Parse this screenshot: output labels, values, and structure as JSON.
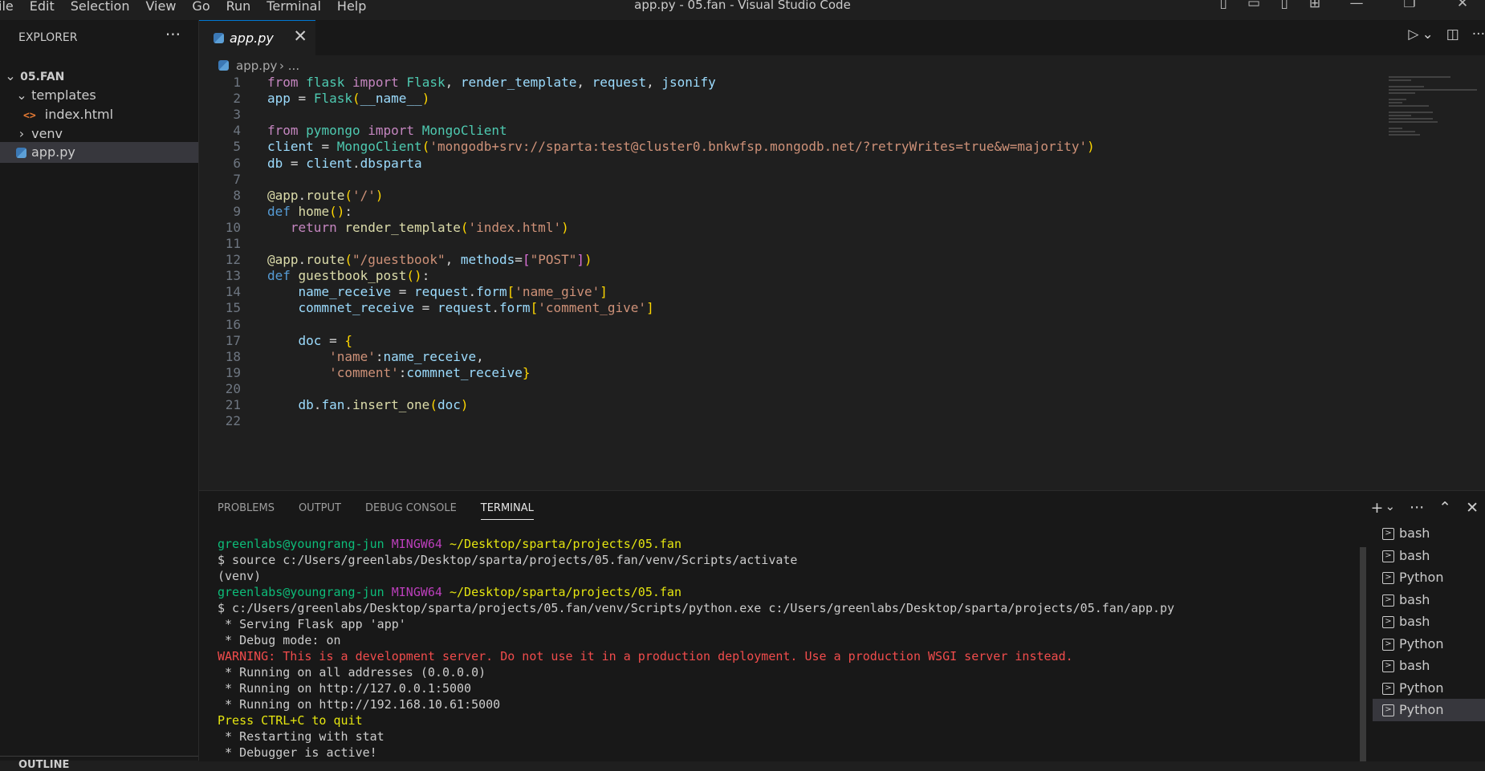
{
  "menu": [
    "ile",
    "Edit",
    "Selection",
    "View",
    "Go",
    "Run",
    "Terminal",
    "Help"
  ],
  "window_title": "app.py - 05.fan - Visual Studio Code",
  "sidebar": {
    "header": "EXPLORER",
    "more": "···",
    "root": "05.FAN",
    "items": [
      {
        "label": "templates"
      },
      {
        "label": "index.html"
      },
      {
        "label": "venv"
      },
      {
        "label": "app.py"
      }
    ],
    "outline": "OUTLINE"
  },
  "tab": {
    "label": "app.py",
    "close": "✕"
  },
  "breadcrumb": {
    "file": "app.py",
    "more": "..."
  },
  "code": {
    "lines": [
      "from flask import Flask, render_template, request, jsonify",
      "app = Flask(__name__)",
      "",
      "from pymongo import MongoClient",
      "client = MongoClient('mongodb+srv://sparta:test@cluster0.bnkwfsp.mongodb.net/?retryWrites=true&w=majority')",
      "db = client.dbsparta",
      "",
      "@app.route('/')",
      "def home():",
      "   return render_template('index.html')",
      "",
      "@app.route(\"/guestbook\", methods=[\"POST\"])",
      "def guestbook_post():",
      "    name_receive = request.form['name_give']",
      "    commnet_receive = request.form['comment_give']",
      "",
      "    doc = {",
      "        'name':name_receive,",
      "        'comment':commnet_receive}",
      "",
      "    db.fan.insert_one(doc)",
      ""
    ]
  },
  "panel": {
    "tabs": [
      "PROBLEMS",
      "OUTPUT",
      "DEBUG CONSOLE",
      "TERMINAL"
    ],
    "active_tab": "TERMINAL"
  },
  "terminal": {
    "user1": "greenlabs@youngrang-jun",
    "env1": "MINGW64",
    "path1": "~/Desktop/sparta/projects/05.fan",
    "cmd1": "$ source c:/Users/greenlabs/Desktop/sparta/projects/05.fan/venv/Scripts/activate",
    "venv": "(venv)",
    "user2": "greenlabs@youngrang-jun",
    "env2": "MINGW64",
    "path2": "~/Desktop/sparta/projects/05.fan",
    "cmd2": "$ c:/Users/greenlabs/Desktop/sparta/projects/05.fan/venv/Scripts/python.exe c:/Users/greenlabs/Desktop/sparta/projects/05.fan/app.py",
    "out1": " * Serving Flask app 'app'",
    "out2": " * Debug mode: on",
    "warning": "WARNING: This is a development server. Do not use it in a production deployment. Use a production WSGI server instead.",
    "out3": " * Running on all addresses (0.0.0.0)",
    "out4": " * Running on http://127.0.0.1:5000",
    "out5": " * Running on http://192.168.10.61:5000",
    "quit": "Press CTRL+C to quit",
    "out6": " * Restarting with stat",
    "out7": " * Debugger is active!"
  },
  "terminals": [
    "bash",
    "bash",
    "Python",
    "bash",
    "bash",
    "Python",
    "bash",
    "Python",
    "Python"
  ],
  "colors": {
    "accent": "#0078d4",
    "background": "#1f1f1f",
    "sidebar": "#181818"
  }
}
